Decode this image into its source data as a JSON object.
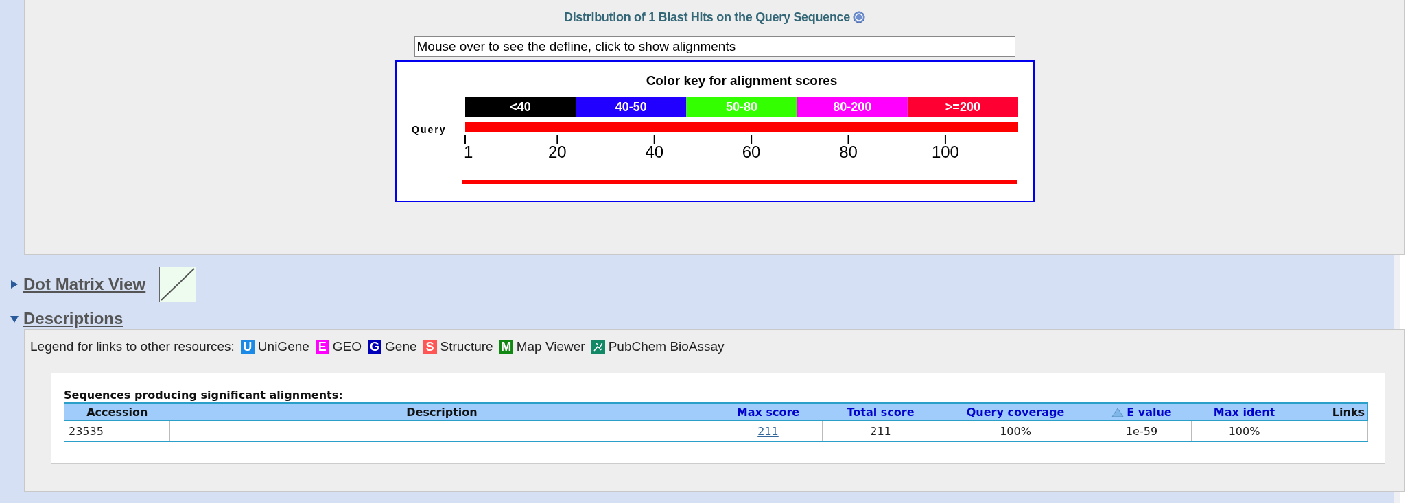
{
  "graphic_summary": {
    "title": "Distribution of 1 Blast Hits on the Query Sequence",
    "defline_box": {
      "value": "Mouse over to see the defline, click to show alignments"
    },
    "color_key": {
      "title": "Color key for alignment scores",
      "ranges": [
        {
          "label": "<40",
          "color": "#000000"
        },
        {
          "label": "40-50",
          "color": "#2200ff"
        },
        {
          "label": "50-80",
          "color": "#33ff00"
        },
        {
          "label": "80-200",
          "color": "#ff00ff"
        },
        {
          "label": ">=200",
          "color": "#ff0033"
        }
      ]
    },
    "query_label": "Query",
    "scale_ticks": [
      "1",
      "20",
      "40",
      "60",
      "80",
      "100"
    ],
    "hits": [
      {
        "color": "#ff0000"
      }
    ]
  },
  "sections": [
    {
      "label": "Dot Matrix View",
      "expanded": false
    },
    {
      "label": "Descriptions",
      "expanded": true
    }
  ],
  "legend": {
    "label": "Legend for links to other resources:",
    "items": [
      {
        "badge": "U",
        "label": "UniGene",
        "color": "#1a8ae6"
      },
      {
        "badge": "E",
        "label": "GEO",
        "color": "#ff00ff"
      },
      {
        "badge": "G",
        "label": "Gene",
        "color": "#0000bb"
      },
      {
        "badge": "S",
        "label": "Structure",
        "color": "#ff5555"
      },
      {
        "badge": "M",
        "label": "Map Viewer",
        "color": "#118811"
      },
      {
        "label": "PubChem BioAssay",
        "color": "#118866"
      }
    ]
  },
  "table": {
    "caption": "Sequences producing significant alignments:",
    "columns": [
      {
        "label": "Accession",
        "link": false,
        "sorted": false
      },
      {
        "label": "Description",
        "link": false,
        "sorted": false
      },
      {
        "label": "Max score",
        "link": true,
        "sorted": false
      },
      {
        "label": "Total score",
        "link": true,
        "sorted": false
      },
      {
        "label": "Query coverage",
        "link": true,
        "sorted": false
      },
      {
        "label": "E value",
        "link": true,
        "sorted": true
      },
      {
        "label": "Max ident",
        "link": true,
        "sorted": false
      },
      {
        "label": "Links",
        "link": false,
        "sorted": false
      }
    ],
    "rows": [
      {
        "cells": [
          {
            "text": "23535",
            "link": false
          },
          null,
          {
            "text": "211",
            "link": true
          },
          {
            "text": "211",
            "link": false
          },
          {
            "text": "100%",
            "link": false
          },
          {
            "text": "1e-59",
            "link": false
          },
          {
            "text": "100%",
            "link": false
          },
          null
        ]
      }
    ]
  }
}
